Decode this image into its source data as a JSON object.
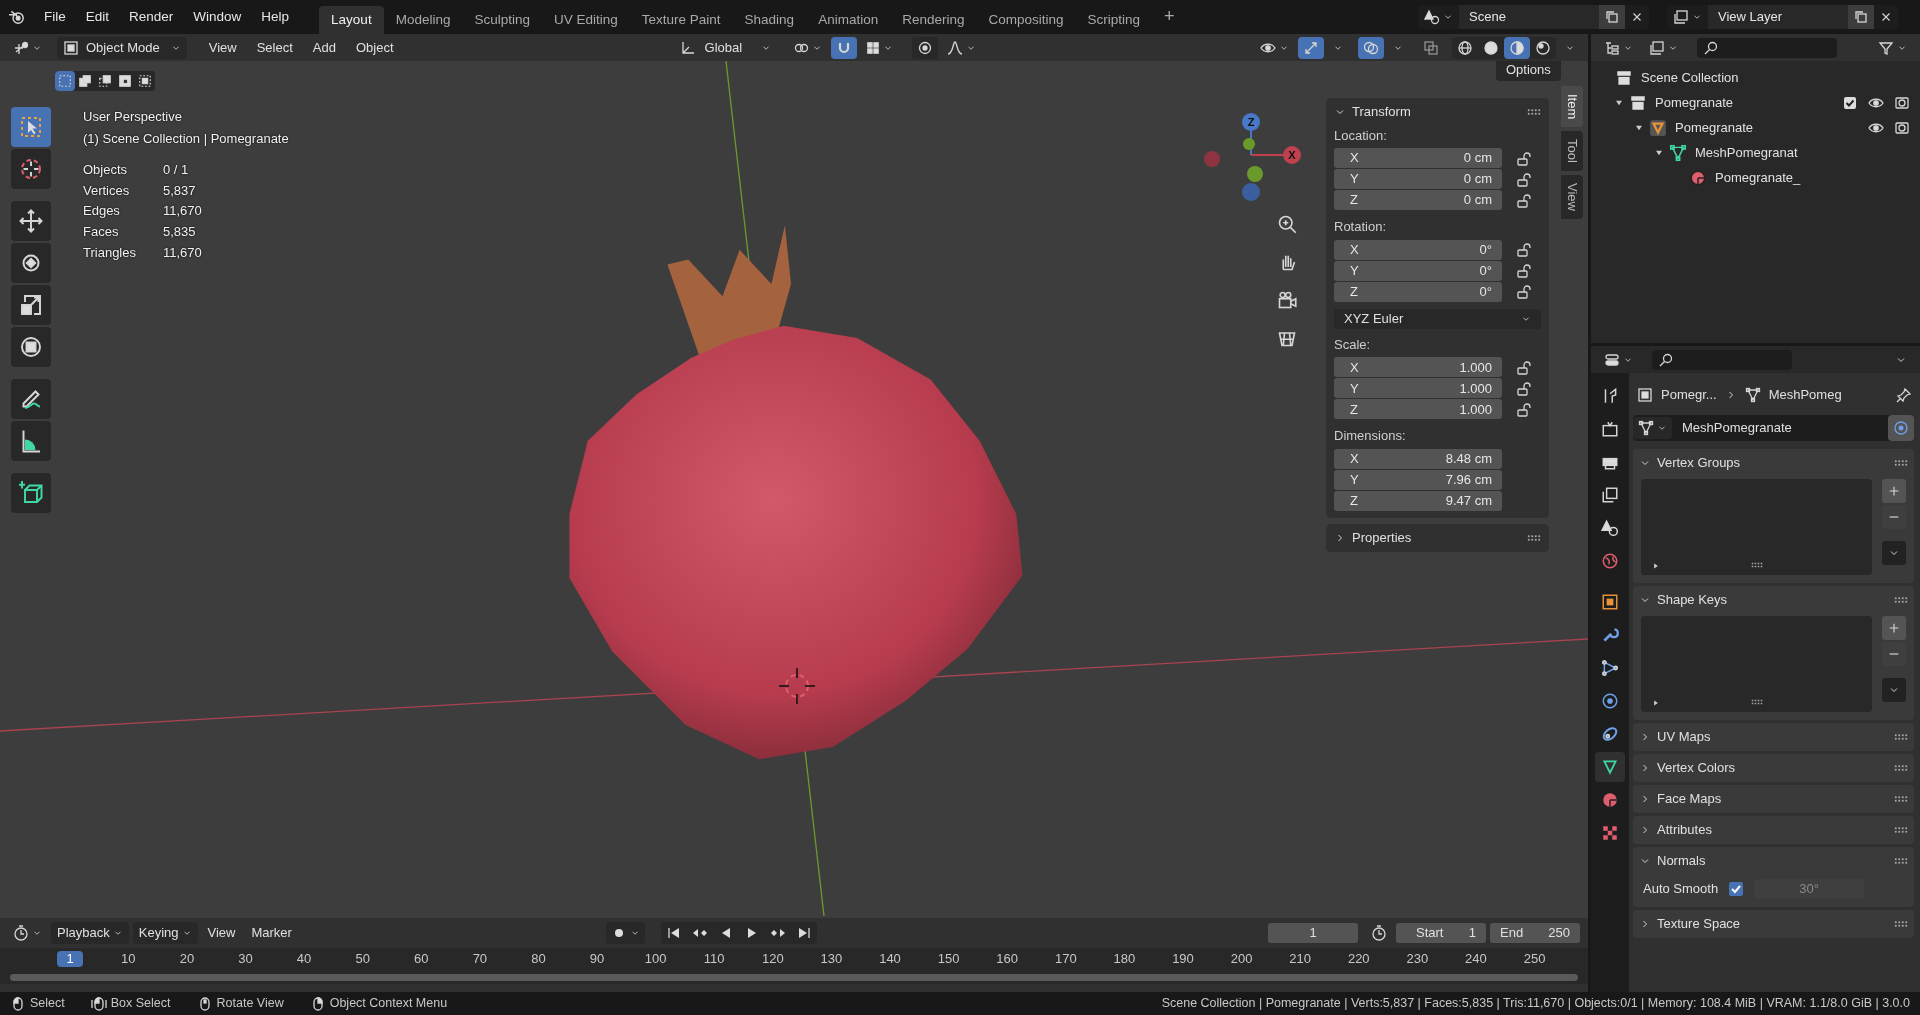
{
  "top_menu": [
    "File",
    "Edit",
    "Render",
    "Window",
    "Help"
  ],
  "workspaces": [
    {
      "label": "Layout",
      "selected": true
    },
    {
      "label": "Modeling",
      "selected": false
    },
    {
      "label": "Sculpting",
      "selected": false
    },
    {
      "label": "UV Editing",
      "selected": false
    },
    {
      "label": "Texture Paint",
      "selected": false
    },
    {
      "label": "Shading",
      "selected": false
    },
    {
      "label": "Animation",
      "selected": false
    },
    {
      "label": "Rendering",
      "selected": false
    },
    {
      "label": "Compositing",
      "selected": false
    },
    {
      "label": "Scripting",
      "selected": false
    }
  ],
  "add_workspace": "+",
  "scene_selector": {
    "value": "Scene"
  },
  "view_layer_selector": {
    "value": "View Layer"
  },
  "viewport_header": {
    "mode": "Object Mode",
    "menus": [
      "View",
      "Select",
      "Add",
      "Object"
    ],
    "orientation": "Global",
    "snap_on": true,
    "proportional_editing_on": false,
    "gizmos_on": true,
    "overlays_on": true,
    "xray_on": false,
    "shading_modes": [
      {
        "kind": "wireframe",
        "selected": false
      },
      {
        "kind": "solid",
        "selected": false
      },
      {
        "kind": "material",
        "selected": true
      },
      {
        "kind": "rendered",
        "selected": false
      }
    ]
  },
  "select_modes": [
    {
      "kind": "new",
      "selected": true
    },
    {
      "kind": "extend",
      "selected": false
    },
    {
      "kind": "subtract",
      "selected": false
    },
    {
      "kind": "invert",
      "selected": false
    },
    {
      "kind": "intersect",
      "selected": false
    }
  ],
  "options_button": "Options",
  "viewport_info": {
    "view_name": "User Perspective",
    "collection": "(1) Scene Collection | Pomegranate",
    "stats": [
      {
        "label": "Objects",
        "value": "0 / 1"
      },
      {
        "label": "Vertices",
        "value": "5,837"
      },
      {
        "label": "Edges",
        "value": "11,670"
      },
      {
        "label": "Faces",
        "value": "5,835"
      },
      {
        "label": "Triangles",
        "value": "11,670"
      }
    ]
  },
  "tools": [
    {
      "kind": "select_box",
      "selected": true
    },
    {
      "kind": "cursor",
      "selected": false
    },
    {
      "kind": "move",
      "selected": false
    },
    {
      "kind": "rotate",
      "selected": false
    },
    {
      "kind": "scale",
      "selected": false
    },
    {
      "kind": "transform",
      "selected": false
    },
    {
      "kind": "annotate",
      "selected": false
    },
    {
      "kind": "measure",
      "selected": false
    },
    {
      "kind": "add_cube",
      "selected": false
    }
  ],
  "gizmo_labels": [
    "Z",
    "X"
  ],
  "sidebar_tabs": [
    {
      "label": "Item",
      "selected": true
    },
    {
      "label": "Tool",
      "selected": false
    },
    {
      "label": "View",
      "selected": false
    }
  ],
  "transform_panel": {
    "title": "Transform",
    "expanded": true,
    "rotation_mode": "XYZ Euler",
    "groups": [
      {
        "label": "Location:",
        "locks": true,
        "fields": [
          {
            "axis": "X",
            "value": "0 cm"
          },
          {
            "axis": "Y",
            "value": "0 cm"
          },
          {
            "axis": "Z",
            "value": "0 cm"
          }
        ]
      },
      {
        "label": "Rotation:",
        "locks": true,
        "fields": [
          {
            "axis": "X",
            "value": "0°"
          },
          {
            "axis": "Y",
            "value": "0°"
          },
          {
            "axis": "Z",
            "value": "0°"
          }
        ]
      },
      {
        "label": "Scale:",
        "locks": true,
        "fields": [
          {
            "axis": "X",
            "value": "1.000"
          },
          {
            "axis": "Y",
            "value": "1.000"
          },
          {
            "axis": "Z",
            "value": "1.000"
          }
        ]
      },
      {
        "label": "Dimensions:",
        "locks": false,
        "fields": [
          {
            "axis": "X",
            "value": "8.48 cm"
          },
          {
            "axis": "Y",
            "value": "7.96 cm"
          },
          {
            "axis": "Z",
            "value": "9.47 cm"
          }
        ]
      }
    ]
  },
  "properties_panel": {
    "title": "Properties",
    "expanded": false
  },
  "outliner": {
    "root": "Scene Collection",
    "items": [
      {
        "label": "Pomegranate",
        "kind": "collection",
        "expanded": true,
        "checked": true,
        "visible": true,
        "renderable": true,
        "children": [
          {
            "label": "Pomegranate",
            "kind": "object",
            "expanded": true,
            "visible": true,
            "renderable": true,
            "children": [
              {
                "label": "MeshPomegranat",
                "kind": "mesh",
                "expanded": true,
                "children": [
                  {
                    "label": "Pomegranate_",
                    "kind": "material"
                  }
                ]
              }
            ]
          }
        ]
      }
    ]
  },
  "properties_editor": {
    "tabs": [
      {
        "kind": "tool",
        "selected": false
      },
      {
        "kind": "render",
        "selected": false
      },
      {
        "kind": "output",
        "selected": false
      },
      {
        "kind": "view_layer",
        "selected": false
      },
      {
        "kind": "scene",
        "selected": false
      },
      {
        "kind": "world",
        "selected": false
      },
      {
        "kind": "object",
        "selected": false
      },
      {
        "kind": "modifiers",
        "selected": false
      },
      {
        "kind": "particles",
        "selected": false
      },
      {
        "kind": "physics",
        "selected": false
      },
      {
        "kind": "constraints",
        "selected": false
      },
      {
        "kind": "data",
        "selected": true
      },
      {
        "kind": "material",
        "selected": false
      },
      {
        "kind": "texture",
        "selected": false
      }
    ],
    "breadcrumb": [
      "Pomegr...",
      "MeshPomeg"
    ],
    "datablock": "MeshPomegranate",
    "panels": [
      {
        "title": "Vertex Groups",
        "kind": "list",
        "expanded": true
      },
      {
        "title": "Shape Keys",
        "kind": "list",
        "expanded": true
      },
      {
        "title": "UV Maps",
        "expanded": false
      },
      {
        "title": "Vertex Colors",
        "expanded": false
      },
      {
        "title": "Face Maps",
        "expanded": false
      },
      {
        "title": "Attributes",
        "expanded": false
      },
      {
        "title": "Normals",
        "kind": "normals",
        "expanded": true,
        "auto_smooth": {
          "label": "Auto Smooth",
          "checked": true,
          "angle": "30°"
        }
      },
      {
        "title": "Texture Space",
        "expanded": false
      }
    ]
  },
  "timeline": {
    "menus": [
      "Playback",
      "Keying",
      "View",
      "Marker"
    ],
    "current_frame": "1",
    "start_label": "Start",
    "start": "1",
    "end_label": "End",
    "end": "250",
    "ruler": [
      {
        "label": "1",
        "selected": true
      },
      {
        "label": "10",
        "selected": false
      },
      {
        "label": "20",
        "selected": false
      },
      {
        "label": "30",
        "selected": false
      },
      {
        "label": "40",
        "selected": false
      },
      {
        "label": "50",
        "selected": false
      },
      {
        "label": "60",
        "selected": false
      },
      {
        "label": "70",
        "selected": false
      },
      {
        "label": "80",
        "selected": false
      },
      {
        "label": "90",
        "selected": false
      },
      {
        "label": "100",
        "selected": false
      },
      {
        "label": "110",
        "selected": false
      },
      {
        "label": "120",
        "selected": false
      },
      {
        "label": "130",
        "selected": false
      },
      {
        "label": "140",
        "selected": false
      },
      {
        "label": "150",
        "selected": false
      },
      {
        "label": "160",
        "selected": false
      },
      {
        "label": "170",
        "selected": false
      },
      {
        "label": "180",
        "selected": false
      },
      {
        "label": "190",
        "selected": false
      },
      {
        "label": "200",
        "selected": false
      },
      {
        "label": "210",
        "selected": false
      },
      {
        "label": "220",
        "selected": false
      },
      {
        "label": "230",
        "selected": false
      },
      {
        "label": "240",
        "selected": false
      },
      {
        "label": "250",
        "selected": false
      }
    ]
  },
  "status_bar": {
    "hints": [
      {
        "kind": "left",
        "label": "Select"
      },
      {
        "kind": "left_drag",
        "label": "Box Select"
      },
      {
        "kind": "middle",
        "label": "Rotate View"
      },
      {
        "kind": "right",
        "label": "Object Context Menu"
      }
    ],
    "stats": "Scene Collection | Pomegranate | Verts:5,837 | Faces:5,835 | Tris:11,670 | Objects:0/1 | Memory: 108.4 MiB | VRAM: 1.1/8.0 GiB | 3.0.0"
  }
}
